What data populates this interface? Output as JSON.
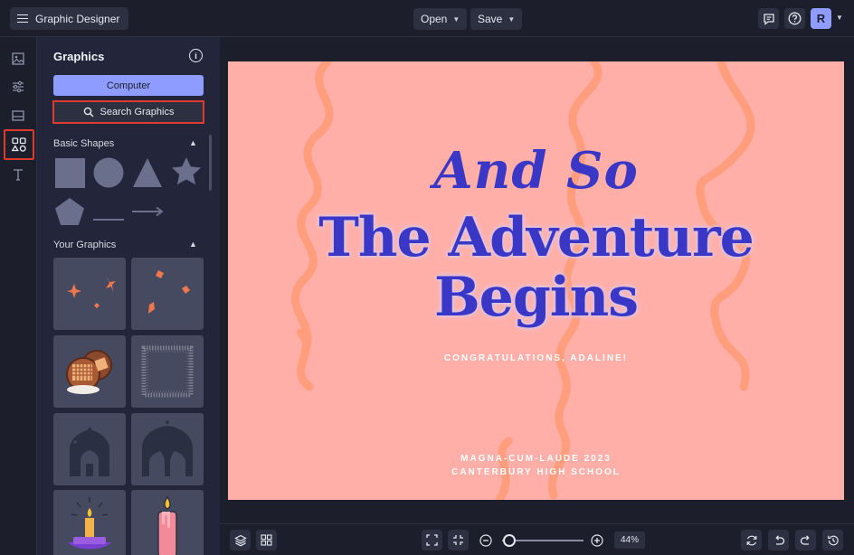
{
  "topbar": {
    "app_title": "Graphic Designer",
    "open_label": "Open",
    "save_label": "Save",
    "avatar_initial": "R"
  },
  "panel": {
    "title": "Graphics",
    "computer_button": "Computer",
    "search_button": "Search Graphics",
    "section_basic_shapes": "Basic Shapes",
    "section_your_graphics": "Your Graphics"
  },
  "canvas": {
    "line1": "And So",
    "line2": "The Adventure",
    "line3": "Begins",
    "congrats": "CONGRATULATIONS, ADALINE!",
    "honor": "MAGNA-CUM-LAUDE 2023",
    "school": "CANTERBURY HIGH SCHOOL",
    "background_color": "#ffafa8",
    "text_color": "#3a37c7"
  },
  "bottombar": {
    "zoom_value": "44%"
  },
  "colors": {
    "accent": "#8e9bff",
    "highlight": "#e03a2e",
    "panel_bg": "#23263a",
    "ribbon": "#ff9a76"
  }
}
